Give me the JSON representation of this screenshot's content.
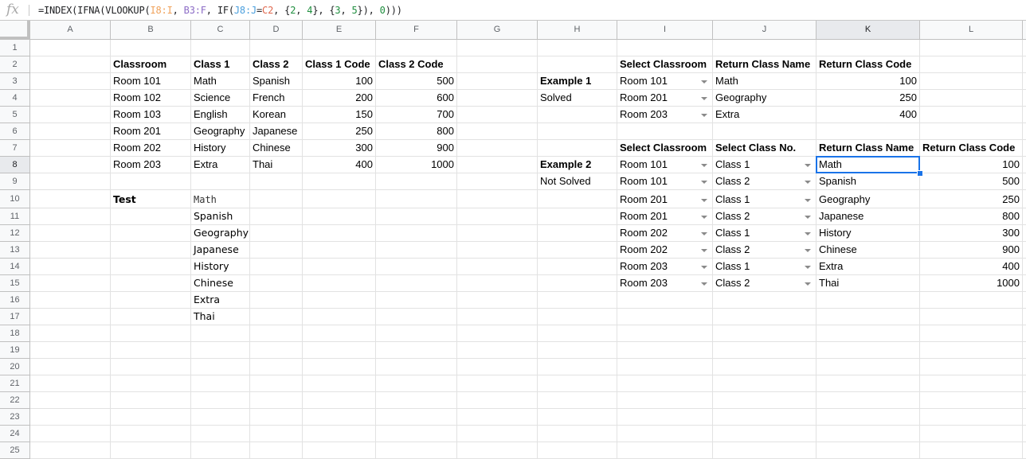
{
  "formula_bar": {
    "icon": "fx-icon",
    "tokens": [
      {
        "t": "=INDEX(IFNA(VLOOKUP(",
        "c": ""
      },
      {
        "t": "I8:I",
        "c": "orange"
      },
      {
        "t": ", ",
        "c": ""
      },
      {
        "t": "B3:F",
        "c": "purple"
      },
      {
        "t": ", IF(",
        "c": ""
      },
      {
        "t": "J8:J",
        "c": "blue"
      },
      {
        "t": "=",
        "c": ""
      },
      {
        "t": "C2",
        "c": "red"
      },
      {
        "t": ", {",
        "c": ""
      },
      {
        "t": "2",
        "c": "green"
      },
      {
        "t": ", ",
        "c": ""
      },
      {
        "t": "4",
        "c": "green"
      },
      {
        "t": "}, {",
        "c": ""
      },
      {
        "t": "3",
        "c": "green"
      },
      {
        "t": ", ",
        "c": ""
      },
      {
        "t": "5",
        "c": "green"
      },
      {
        "t": "}), ",
        "c": ""
      },
      {
        "t": "0",
        "c": "green"
      },
      {
        "t": ")))",
        "c": ""
      }
    ]
  },
  "columns": [
    "A",
    "B",
    "C",
    "D",
    "E",
    "F",
    "G",
    "H",
    "I",
    "J",
    "K",
    "L"
  ],
  "active_column": "K",
  "rows": [
    1,
    2,
    3,
    4,
    5,
    6,
    7,
    8,
    9,
    10,
    11,
    12,
    13,
    14,
    15,
    16,
    17,
    18,
    19,
    20,
    21,
    22,
    23,
    24,
    25
  ],
  "active_row": 8,
  "selected_cell": "K8",
  "cells": [
    {
      "ref": "B2",
      "v": "Classroom",
      "s": "bold"
    },
    {
      "ref": "C2",
      "v": "Class 1",
      "s": "bold"
    },
    {
      "ref": "D2",
      "v": "Class 2",
      "s": "bold"
    },
    {
      "ref": "E2",
      "v": "Class 1 Code",
      "s": "bold"
    },
    {
      "ref": "F2",
      "v": "Class 2 Code",
      "s": "bold"
    },
    {
      "ref": "B3",
      "v": "Room 101"
    },
    {
      "ref": "C3",
      "v": "Math"
    },
    {
      "ref": "D3",
      "v": "Spanish"
    },
    {
      "ref": "E3",
      "v": "100",
      "s": "num"
    },
    {
      "ref": "F3",
      "v": "500",
      "s": "num"
    },
    {
      "ref": "B4",
      "v": "Room 102"
    },
    {
      "ref": "C4",
      "v": "Science"
    },
    {
      "ref": "D4",
      "v": "French"
    },
    {
      "ref": "E4",
      "v": "200",
      "s": "num"
    },
    {
      "ref": "F4",
      "v": "600",
      "s": "num"
    },
    {
      "ref": "B5",
      "v": "Room 103"
    },
    {
      "ref": "C5",
      "v": "English"
    },
    {
      "ref": "D5",
      "v": "Korean"
    },
    {
      "ref": "E5",
      "v": "150",
      "s": "num"
    },
    {
      "ref": "F5",
      "v": "700",
      "s": "num"
    },
    {
      "ref": "B6",
      "v": "Room 201"
    },
    {
      "ref": "C6",
      "v": "Geography"
    },
    {
      "ref": "D6",
      "v": "Japanese"
    },
    {
      "ref": "E6",
      "v": "250",
      "s": "num"
    },
    {
      "ref": "F6",
      "v": "800",
      "s": "num"
    },
    {
      "ref": "B7",
      "v": "Room 202"
    },
    {
      "ref": "C7",
      "v": "History"
    },
    {
      "ref": "D7",
      "v": "Chinese"
    },
    {
      "ref": "E7",
      "v": "300",
      "s": "num"
    },
    {
      "ref": "F7",
      "v": "900",
      "s": "num"
    },
    {
      "ref": "B8",
      "v": "Room 203"
    },
    {
      "ref": "C8",
      "v": "Extra"
    },
    {
      "ref": "D8",
      "v": "Thai"
    },
    {
      "ref": "E8",
      "v": "400",
      "s": "num"
    },
    {
      "ref": "F8",
      "v": "1000",
      "s": "num"
    },
    {
      "ref": "B10",
      "v": "Test",
      "s": "bold dejavu"
    },
    {
      "ref": "C10",
      "v": "Math",
      "s": "mono"
    },
    {
      "ref": "C11",
      "v": "Spanish",
      "s": "dejavu"
    },
    {
      "ref": "C12",
      "v": "Geography",
      "s": "dejavu"
    },
    {
      "ref": "C13",
      "v": "Japanese",
      "s": "dejavu"
    },
    {
      "ref": "C14",
      "v": "History",
      "s": "dejavu"
    },
    {
      "ref": "C15",
      "v": "Chinese",
      "s": "dejavu"
    },
    {
      "ref": "C16",
      "v": "Extra",
      "s": "dejavu"
    },
    {
      "ref": "C17",
      "v": "Thai",
      "s": "dejavu"
    },
    {
      "ref": "I2",
      "v": "Select Classroom",
      "s": "bold"
    },
    {
      "ref": "J2",
      "v": "Return Class Name",
      "s": "bold"
    },
    {
      "ref": "K2",
      "v": "Return Class Code",
      "s": "bold"
    },
    {
      "ref": "H3",
      "v": "Example 1",
      "s": "bold"
    },
    {
      "ref": "H4",
      "v": "Solved"
    },
    {
      "ref": "I3",
      "v": "Room 101",
      "s": "dropdown"
    },
    {
      "ref": "J3",
      "v": "Math"
    },
    {
      "ref": "K3",
      "v": "100",
      "s": "num"
    },
    {
      "ref": "I4",
      "v": "Room 201",
      "s": "dropdown"
    },
    {
      "ref": "J4",
      "v": "Geography"
    },
    {
      "ref": "K4",
      "v": "250",
      "s": "num"
    },
    {
      "ref": "I5",
      "v": "Room 203",
      "s": "dropdown"
    },
    {
      "ref": "J5",
      "v": "Extra"
    },
    {
      "ref": "K5",
      "v": "400",
      "s": "num"
    },
    {
      "ref": "I7",
      "v": "Select Classroom",
      "s": "bold"
    },
    {
      "ref": "J7",
      "v": "Select Class No.",
      "s": "bold"
    },
    {
      "ref": "K7",
      "v": "Return Class Name",
      "s": "bold"
    },
    {
      "ref": "L7",
      "v": "Return Class Code",
      "s": "bold"
    },
    {
      "ref": "H8",
      "v": "Example 2",
      "s": "bold"
    },
    {
      "ref": "H9",
      "v": "Not Solved"
    },
    {
      "ref": "I8",
      "v": "Room 101",
      "s": "dropdown"
    },
    {
      "ref": "J8",
      "v": "Class 1",
      "s": "dropdown"
    },
    {
      "ref": "K8",
      "v": "Math"
    },
    {
      "ref": "L8",
      "v": "100",
      "s": "num"
    },
    {
      "ref": "I9",
      "v": "Room 101",
      "s": "dropdown"
    },
    {
      "ref": "J9",
      "v": "Class 2",
      "s": "dropdown"
    },
    {
      "ref": "K9",
      "v": "Spanish"
    },
    {
      "ref": "L9",
      "v": "500",
      "s": "num"
    },
    {
      "ref": "I10",
      "v": "Room 201",
      "s": "dropdown"
    },
    {
      "ref": "J10",
      "v": "Class 1",
      "s": "dropdown"
    },
    {
      "ref": "K10",
      "v": "Geography"
    },
    {
      "ref": "L10",
      "v": "250",
      "s": "num"
    },
    {
      "ref": "I11",
      "v": "Room 201",
      "s": "dropdown"
    },
    {
      "ref": "J11",
      "v": "Class 2",
      "s": "dropdown"
    },
    {
      "ref": "K11",
      "v": "Japanese"
    },
    {
      "ref": "L11",
      "v": "800",
      "s": "num"
    },
    {
      "ref": "I12",
      "v": "Room 202",
      "s": "dropdown"
    },
    {
      "ref": "J12",
      "v": "Class 1",
      "s": "dropdown"
    },
    {
      "ref": "K12",
      "v": "History"
    },
    {
      "ref": "L12",
      "v": "300",
      "s": "num"
    },
    {
      "ref": "I13",
      "v": "Room 202",
      "s": "dropdown"
    },
    {
      "ref": "J13",
      "v": "Class 2",
      "s": "dropdown"
    },
    {
      "ref": "K13",
      "v": "Chinese"
    },
    {
      "ref": "L13",
      "v": "900",
      "s": "num"
    },
    {
      "ref": "I14",
      "v": "Room 203",
      "s": "dropdown"
    },
    {
      "ref": "J14",
      "v": "Class 1",
      "s": "dropdown"
    },
    {
      "ref": "K14",
      "v": "Extra"
    },
    {
      "ref": "L14",
      "v": "400",
      "s": "num"
    },
    {
      "ref": "I15",
      "v": "Room 203",
      "s": "dropdown"
    },
    {
      "ref": "J15",
      "v": "Class 2",
      "s": "dropdown"
    },
    {
      "ref": "K15",
      "v": "Thai"
    },
    {
      "ref": "L15",
      "v": "1000",
      "s": "num"
    }
  ]
}
